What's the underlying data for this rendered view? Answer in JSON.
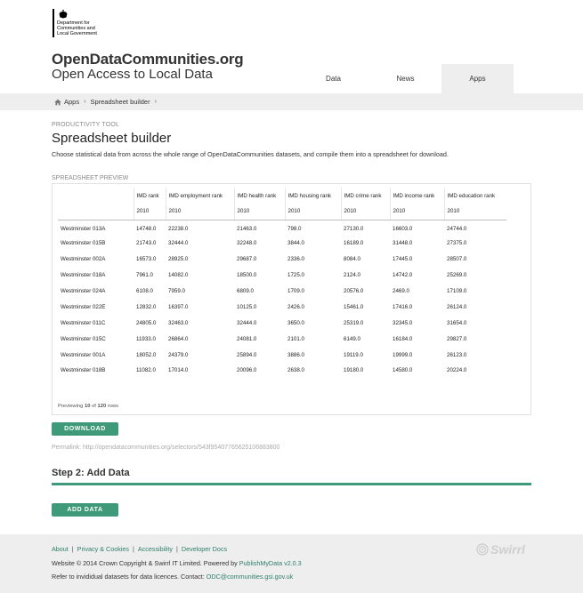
{
  "gov": {
    "line1": "Department for",
    "line2": "Communities and",
    "line3": "Local Government"
  },
  "site": {
    "name": "OpenDataCommunities.org",
    "tagline": "Open Access to Local Data"
  },
  "nav": {
    "tabs": [
      {
        "label": "Data",
        "active": false
      },
      {
        "label": "News",
        "active": false
      },
      {
        "label": "Apps",
        "active": true
      }
    ]
  },
  "breadcrumb": {
    "items": [
      "Apps",
      "Spreadsheet builder"
    ],
    "separator": "›"
  },
  "page": {
    "eyebrow": "PRODUCTIVITY TOOL",
    "title": "Spreadsheet builder",
    "intro": "Choose statistical data from across the whole range of OpenDataCommunities datasets, and compile them into a spreadsheet for download."
  },
  "preview": {
    "label": "SPREADSHEET PREVIEW",
    "columns": [
      {
        "name": "",
        "year": ""
      },
      {
        "name": "IMD rank",
        "year": "2010"
      },
      {
        "name": "IMD employment rank",
        "year": "2010"
      },
      {
        "name": "IMD health rank",
        "year": "2010"
      },
      {
        "name": "IMD housing rank",
        "year": "2010"
      },
      {
        "name": "IMD crime rank",
        "year": "2010"
      },
      {
        "name": "IMD income rank",
        "year": "2010"
      },
      {
        "name": "IMD education rank",
        "year": "2010"
      }
    ],
    "rows": [
      [
        "Westminster 013A",
        "14748.0",
        "22238.0",
        "21463.0",
        "798.0",
        "27130.0",
        "16603.0",
        "24744.0"
      ],
      [
        "Westminster 015B",
        "21743.0",
        "32444.0",
        "32248.0",
        "3844.0",
        "16189.0",
        "31448.0",
        "27375.0"
      ],
      [
        "Westminster 002A",
        "16573.0",
        "28925.0",
        "29687.0",
        "2336.0",
        "8084.0",
        "17445.0",
        "28507.0"
      ],
      [
        "Westminster 018A",
        "7961.0",
        "14082.0",
        "18500.0",
        "1725.0",
        "2124.0",
        "14742.0",
        "25269.0"
      ],
      [
        "Westminster 024A",
        "6108.0",
        "7959.0",
        "6809.0",
        "1709.0",
        "20576.0",
        "2469.0",
        "17109.0"
      ],
      [
        "Westminster 022E",
        "12832.0",
        "16397.0",
        "10125.0",
        "2426.0",
        "15461.0",
        "17416.0",
        "26124.0"
      ],
      [
        "Westminster 011C",
        "24805.0",
        "32463.0",
        "32444.0",
        "3650.0",
        "25319.0",
        "32345.0",
        "31654.0"
      ],
      [
        "Westminster 015C",
        "11933.0",
        "26864.0",
        "24081.0",
        "2101.0",
        "6149.0",
        "16184.0",
        "29827.0"
      ],
      [
        "Westminster 001A",
        "18052.0",
        "24379.0",
        "25894.0",
        "3886.0",
        "19119.0",
        "19999.0",
        "26123.0"
      ],
      [
        "Westminster 018B",
        "11082.0",
        "17014.0",
        "20096.0",
        "2638.0",
        "19180.0",
        "14580.0",
        "20224.0"
      ]
    ],
    "count_prefix": "Previewing",
    "count_shown": "10",
    "count_of": "of",
    "count_total": "120",
    "count_suffix": "rows"
  },
  "actions": {
    "download_label": "DOWNLOAD",
    "permalink": "Permalink: http://opendatacommunities.org/selectors/543f95407765625106883800",
    "step2_title": "Step 2: Add Data",
    "add_data_label": "ADD DATA"
  },
  "footer": {
    "links": [
      "About",
      "Privacy & Cookies",
      "Accessibility",
      "Developer Docs"
    ],
    "link_separator": "|",
    "line2_text": "Website © 2014 Crown Copyright & Swirrl IT Limited. Powered by ",
    "line2_link": "PublishMyData v2.0.3",
    "line3_text": "Refer to invididual datasets for data licences. Contact: ",
    "line3_link": "ODC@communities.gsi.gov.uk",
    "brand": "Swirrl"
  },
  "colors": {
    "accent": "#3e9a78",
    "link": "#2e7f6a",
    "band": "#eeeeee"
  },
  "icons": {
    "crest": "royal-crest-icon",
    "home": "home-icon",
    "brand": "swirrl-logo-icon"
  }
}
